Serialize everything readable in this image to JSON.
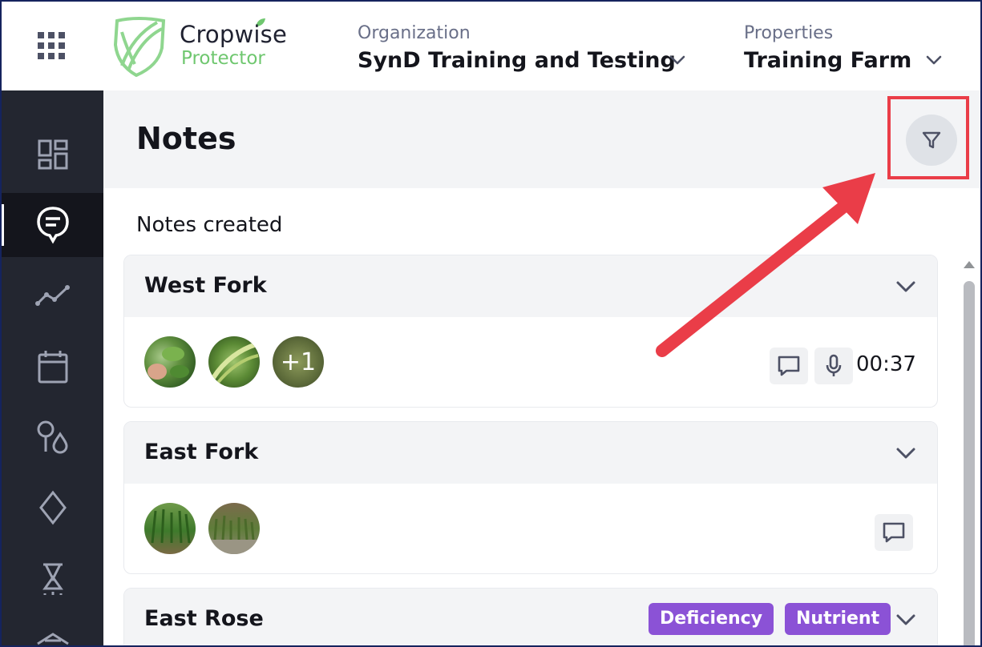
{
  "app": {
    "brand_title": "Cropwise",
    "brand_subtitle": "Protector",
    "accent_green": "#6fc76f",
    "sidebar_bg": "#232630"
  },
  "header": {
    "organization": {
      "label": "Organization",
      "value": "SynD Training and Testing"
    },
    "properties": {
      "label": "Properties",
      "value": "Training Farm"
    }
  },
  "sidebar": {
    "items": [
      {
        "icon": "dashboard-icon",
        "active": false
      },
      {
        "icon": "notes-icon",
        "active": true
      },
      {
        "icon": "trend-chart-icon",
        "active": false
      },
      {
        "icon": "calendar-icon",
        "active": false
      },
      {
        "icon": "pin-drop-icon",
        "active": false
      },
      {
        "icon": "diamond-icon",
        "active": false
      },
      {
        "icon": "trap-icon",
        "active": false
      },
      {
        "icon": "building-icon",
        "active": false
      }
    ]
  },
  "page": {
    "title": "Notes",
    "section_label": "Notes created"
  },
  "notes": [
    {
      "title": "West Fork",
      "more_photos": "+1",
      "duration": "00:37",
      "tags": []
    },
    {
      "title": "East Fork",
      "tags": []
    },
    {
      "title": "East Rose",
      "tags": [
        "Deficiency",
        "Nutrient"
      ]
    }
  ],
  "colors": {
    "highlight_red": "#ea3d48",
    "tag_purple": "#8b52d6"
  }
}
